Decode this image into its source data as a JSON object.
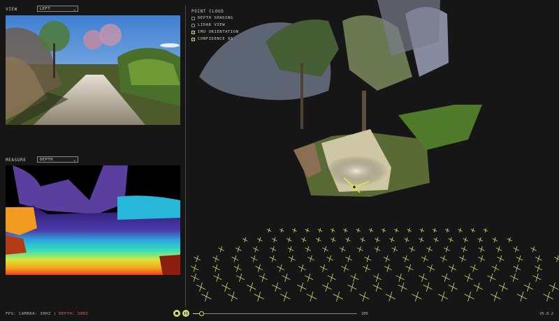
{
  "view": {
    "label": "VIEW",
    "select": "LEFT"
  },
  "measure": {
    "label": "MEASURE",
    "select": "DEPTH"
  },
  "pointcloud": {
    "title": "POINT CLOUD",
    "options": [
      {
        "label": "DEPTH SHADING",
        "checked": false
      },
      {
        "label": "LIDAR VIEW",
        "checked": false
      },
      {
        "label": "IMU ORIENTATION",
        "checked": true
      },
      {
        "label": "CONFIDENCE 95",
        "checked": true
      }
    ]
  },
  "footer": {
    "fps_label": "FPS: CAMERA: 30HZ | ",
    "depth_label": "DEPTH: 30HZ",
    "frame": "205",
    "progress": 0.05,
    "version": "V5.0.2"
  },
  "colors": {
    "accent": "#c8e06a",
    "warning": "#e36d5a"
  },
  "icons": {
    "play": "record-icon",
    "pause": "pause-icon",
    "chevron": "chevron-down-icon"
  }
}
